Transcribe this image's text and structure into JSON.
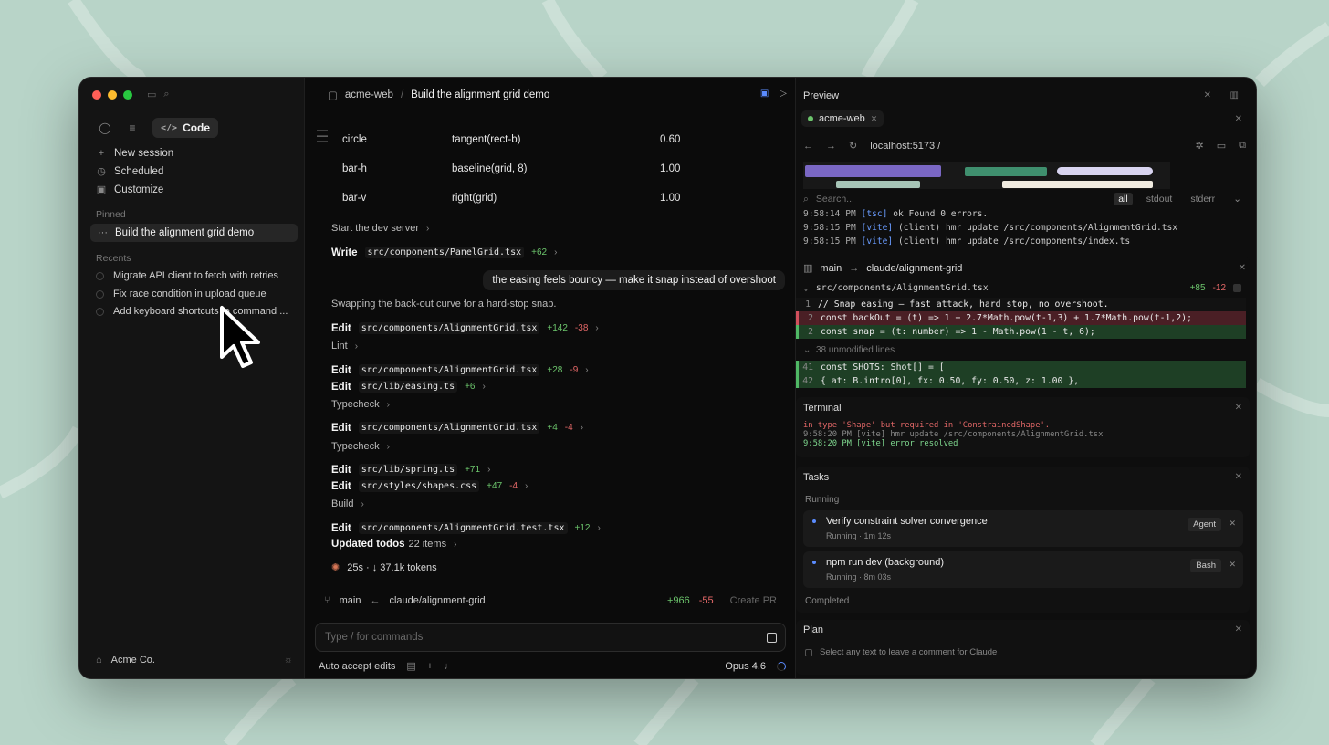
{
  "sidebar": {
    "mode_label": "Code",
    "nav": [
      {
        "label": "New session",
        "icon": "plus-icon"
      },
      {
        "label": "Scheduled",
        "icon": "clock-icon"
      },
      {
        "label": "Customize",
        "icon": "briefcase-icon"
      }
    ],
    "pinned_label": "Pinned",
    "pinned_item": "Build the alignment grid demo",
    "recents_label": "Recents",
    "recents": [
      "Migrate API client to fetch with retries",
      "Fix race condition in upload queue",
      "Add keyboard shortcuts to command ..."
    ],
    "org": "Acme Co."
  },
  "header": {
    "project": "acme-web",
    "separator": "/",
    "session_title": "Build the alignment grid demo"
  },
  "table": [
    {
      "shape": "circle",
      "constraint": "tangent(rect-b)",
      "value": "0.60"
    },
    {
      "shape": "bar-h",
      "constraint": "baseline(grid, 8)",
      "value": "1.00"
    },
    {
      "shape": "bar-v",
      "constraint": "right(grid)",
      "value": "1.00"
    }
  ],
  "transcript": {
    "start_dev": "Start the dev server",
    "write_action": "Write",
    "write_file": "src/components/PanelGrid.tsx",
    "write_add": "+62",
    "user_message": "the easing feels bouncy — make it snap instead of overshoot",
    "assistant_note": "Swapping the back-out curve for a hard-stop snap.",
    "edit_label": "Edit",
    "edits": [
      {
        "file": "src/components/AlignmentGrid.tsx",
        "add": "+142",
        "del": "-38"
      },
      {
        "file": "src/components/AlignmentGrid.tsx",
        "add": "+28",
        "del": "-9"
      },
      {
        "file": "src/lib/easing.ts",
        "add": "+6",
        "del": ""
      },
      {
        "file": "src/components/AlignmentGrid.tsx",
        "add": "+4",
        "del": "-4"
      },
      {
        "file": "src/lib/spring.ts",
        "add": "+71",
        "del": ""
      },
      {
        "file": "src/styles/shapes.css",
        "add": "+47",
        "del": "-4"
      },
      {
        "file": "src/components/AlignmentGrid.test.tsx",
        "add": "+12",
        "del": ""
      }
    ],
    "lint": "Lint",
    "typecheck": "Typecheck",
    "build": "Build",
    "updated_todos": "Updated todos",
    "todos_count": "22 items",
    "status": "25s · ↓ 37.1k tokens"
  },
  "branch_bar": {
    "base": "main",
    "arrow": "←",
    "branch": "claude/alignment-grid",
    "add": "+966",
    "del": "-55",
    "create_pr": "Create PR"
  },
  "composer": {
    "placeholder": "Type / for commands",
    "auto_accept": "Auto accept edits",
    "model": "Opus 4.6"
  },
  "preview": {
    "title": "Preview",
    "tab": "acme-web",
    "url": "localhost:5173 /",
    "search_placeholder": "Search...",
    "filters": [
      "all",
      "stdout",
      "stderr"
    ],
    "logs": [
      {
        "time": "9:58:14 PM",
        "tag": "[tsc]",
        "msg": "ok Found 0 errors."
      },
      {
        "time": "9:58:15 PM",
        "tag": "[vite]",
        "msg": "(client) hmr update /src/components/AlignmentGrid.tsx"
      },
      {
        "time": "9:58:15 PM",
        "tag": "[vite]",
        "msg": "(client) hmr update /src/components/index.ts"
      }
    ]
  },
  "diff": {
    "base": "main",
    "arrow": "→",
    "branch": "claude/alignment-grid",
    "file": "src/components/AlignmentGrid.tsx",
    "add": "+85",
    "del": "-12",
    "lines": [
      {
        "n": "1",
        "kind": "ctx",
        "text": "// Snap easing — fast attack, hard stop, no overshoot."
      },
      {
        "n": "2",
        "kind": "del",
        "text": "const backOut = (t) => 1 + 2.7*Math.pow(t-1,3) + 1.7*Math.pow(t-1,2);"
      },
      {
        "n": "2",
        "kind": "add",
        "text": "const snap = (t: number) => 1 - Math.pow(1 - t, 6);"
      }
    ],
    "unmodified": "38 unmodified lines",
    "lines2": [
      {
        "n": "41",
        "kind": "add",
        "text": "const SHOTS: Shot[] = ["
      },
      {
        "n": "42",
        "kind": "add",
        "text": "  { at: B.intro[0],   fx: 0.50, fy: 0.50, z: 1.00 },"
      }
    ]
  },
  "terminal": {
    "title": "Terminal",
    "lines": [
      {
        "text": "in type 'Shape' but required in 'ConstrainedShape'.",
        "color": "#e26767"
      },
      {
        "text": "9:58:20 PM [vite] hmr update /src/components/AlignmentGrid.tsx",
        "color": "#888888"
      },
      {
        "text": "9:58:20 PM [vite] error resolved",
        "color": "#7fd88f"
      }
    ]
  },
  "tasks": {
    "title": "Tasks",
    "running_label": "Running",
    "items": [
      {
        "title": "Verify constraint solver convergence",
        "status": "Running · 1m 12s",
        "badge": "Agent"
      },
      {
        "title": "npm run dev (background)",
        "status": "Running · 8m 03s",
        "badge": "Bash"
      }
    ],
    "completed_label": "Completed"
  },
  "plan": {
    "title": "Plan",
    "hint": "Select any text to leave a comment for Claude"
  },
  "colors": {
    "accent": "#5b8cff",
    "add": "#6cc56c",
    "del": "#e26767",
    "background": "#b8d4c8"
  }
}
